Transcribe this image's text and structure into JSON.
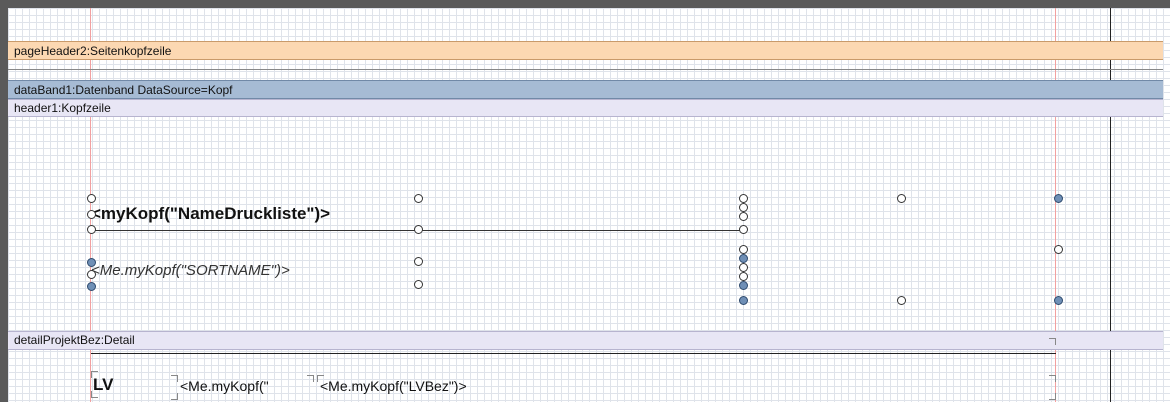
{
  "bands": {
    "page_header": "pageHeader2:Seitenkopfzeile",
    "data_band": "dataBand1:Datenband DataSource=Kopf",
    "header": "header1:Kopfzeile",
    "detail": "detailProjektBez:Detail"
  },
  "fields": {
    "name_druckliste": "<myKopf(\"NameDruckliste\")>",
    "sortname": "<Me.myKopf(\"SORTNAME\")>",
    "lv_label": "LV",
    "lv_field": "<Me.myKopf(\"",
    "lv_bez": "<Me.myKopf(\"LVBez\")>"
  },
  "colors": {
    "page_header_band": "#fcd8b2",
    "data_band": "#a6bbd4",
    "header_band": "#e8e6f5",
    "selection_handle": "#6f8fb6",
    "margin_line": "#f2a0a0"
  }
}
